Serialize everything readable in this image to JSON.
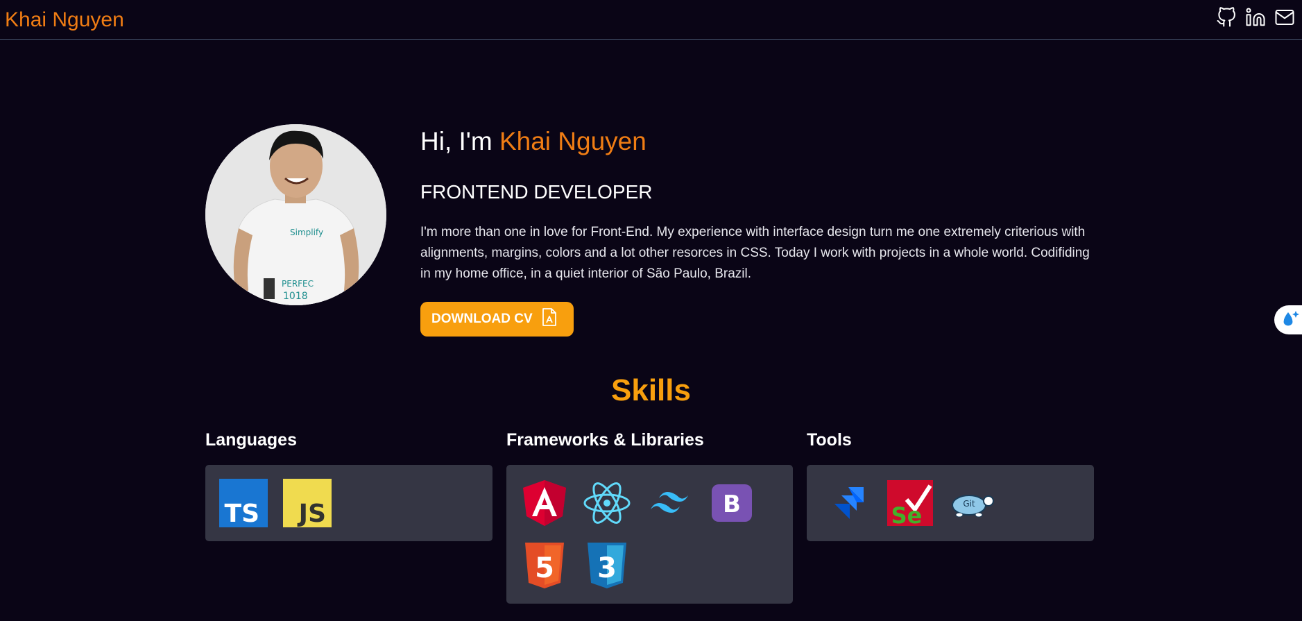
{
  "header": {
    "brand": "Khai Nguyen",
    "social": [
      {
        "icon": "github-icon"
      },
      {
        "icon": "linkedin-icon"
      },
      {
        "icon": "mail-icon"
      }
    ]
  },
  "hero": {
    "greeting": "Hi, I'm",
    "name": "Khai Nguyen",
    "role": "FRONTEND DEVELOPER",
    "bio": "I'm more than one in love for Front-End. My experience with interface design turn me one extremely criterious with alignments, margins, colors and a lot other resorces in CSS. Today I work with projects in a whole world. Codifiding in my home office, in a quiet interior of São Paulo, Brazil.",
    "cv_button": "DOWNLOAD CV"
  },
  "skills": {
    "title": "Skills",
    "categories": [
      {
        "title": "Languages",
        "items": [
          {
            "icon": "typescript-icon",
            "text": "TS"
          },
          {
            "icon": "javascript-icon",
            "text": "JS"
          }
        ]
      },
      {
        "title": "Frameworks & Libraries",
        "items": [
          {
            "icon": "angular-icon"
          },
          {
            "icon": "react-icon"
          },
          {
            "icon": "tailwind-icon"
          },
          {
            "icon": "bootstrap-icon",
            "text": "B"
          },
          {
            "icon": "html5-icon",
            "text": "5"
          },
          {
            "icon": "css3-icon",
            "text": "3"
          }
        ]
      },
      {
        "title": "Tools",
        "items": [
          {
            "icon": "jira-icon"
          },
          {
            "icon": "selenium-icon",
            "text": "Se"
          },
          {
            "icon": "tortoisegit-icon",
            "text": "Git"
          }
        ]
      }
    ]
  },
  "colors": {
    "background": "#0a0516",
    "accent": "#f07d14",
    "button": "#f89f0e",
    "card": "#353644"
  }
}
